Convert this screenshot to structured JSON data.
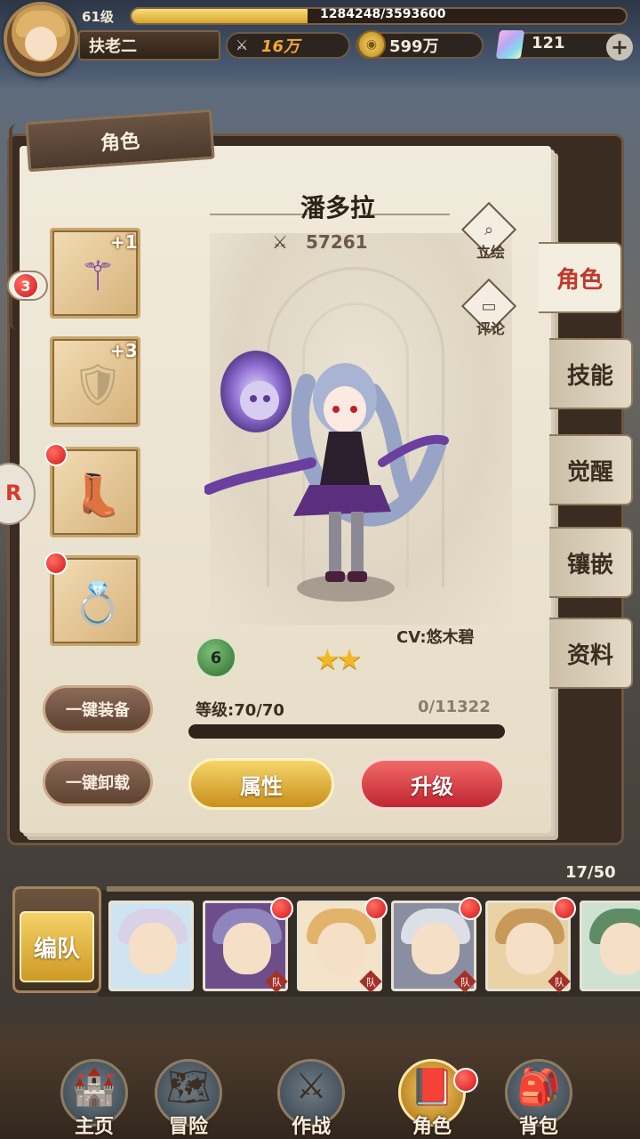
{
  "player": {
    "level": "61级",
    "exp_text": "1284248/3593600",
    "exp_fraction": 0.357,
    "name": "扶老二",
    "power": "16万",
    "gold": "599万",
    "gems": "121",
    "add_label": "+"
  },
  "panel": {
    "title": "角色",
    "chat_badge": "3"
  },
  "hero": {
    "name": "潘多拉",
    "power": "57261",
    "cv": "CV:悠木碧",
    "rank": "6",
    "stars": "★★",
    "star_count": 2,
    "level_text": "等级:70/70",
    "exp_text": "0/11322",
    "exp_fraction": 0
  },
  "hero_actions": [
    {
      "label": "立绘",
      "icon": "magnifier-icon"
    },
    {
      "label": "评论",
      "icon": "speech-bubble-icon"
    }
  ],
  "equipment": [
    {
      "icon": "staff-icon",
      "glyph": "⚚",
      "plus": "+1",
      "has_dot": false,
      "color": "#6b3fa6"
    },
    {
      "icon": "armor-icon",
      "glyph": "🛡",
      "plus": "+3",
      "has_dot": false,
      "color": "#b8a27a"
    },
    {
      "icon": "boots-icon",
      "glyph": "👢",
      "plus": "",
      "has_dot": true,
      "color": "#6d4b3a"
    },
    {
      "icon": "ring-icon",
      "glyph": "💍",
      "plus": "",
      "has_dot": true,
      "color": "#8a3a3a"
    }
  ],
  "buttons": {
    "equip_all": "一键装备",
    "unequip_all": "一键卸载",
    "attributes": "属性",
    "upgrade": "升级"
  },
  "side_tabs": [
    {
      "label": "角色",
      "active": true
    },
    {
      "label": "技能",
      "active": false
    },
    {
      "label": "觉醒",
      "active": false
    },
    {
      "label": "镶嵌",
      "active": false
    },
    {
      "label": "资料",
      "active": false
    }
  ],
  "team": {
    "count": "17/50",
    "button": "编队",
    "tag": "队",
    "cards": [
      {
        "hair": "#d9d2e6",
        "bg": "#cfe4f1",
        "dot": false
      },
      {
        "hair": "#8f86bd",
        "bg": "#6d4e8a",
        "dot": true
      },
      {
        "hair": "#e2b36b",
        "bg": "#f3e3c8",
        "dot": true
      },
      {
        "hair": "#dcdfe6",
        "bg": "#8a8ea0",
        "dot": true
      },
      {
        "hair": "#c79a5a",
        "bg": "#e9d2a6",
        "dot": true
      },
      {
        "hair": "#5e8c66",
        "bg": "#cfe2d2",
        "dot": false
      }
    ]
  },
  "nav": [
    {
      "label": "主页",
      "icon": "home-icon",
      "glyph": "🏰",
      "active": false,
      "dot": false
    },
    {
      "label": "冒险",
      "icon": "adventure-icon",
      "glyph": "🗺",
      "active": false,
      "dot": false
    },
    {
      "label": "作战",
      "icon": "battle-icon",
      "glyph": "⚔",
      "active": false,
      "dot": false
    },
    {
      "label": "角色",
      "icon": "character-book-icon",
      "glyph": "📕",
      "active": true,
      "dot": true
    },
    {
      "label": "背包",
      "icon": "backpack-icon",
      "glyph": "🎒",
      "active": false,
      "dot": false
    }
  ]
}
